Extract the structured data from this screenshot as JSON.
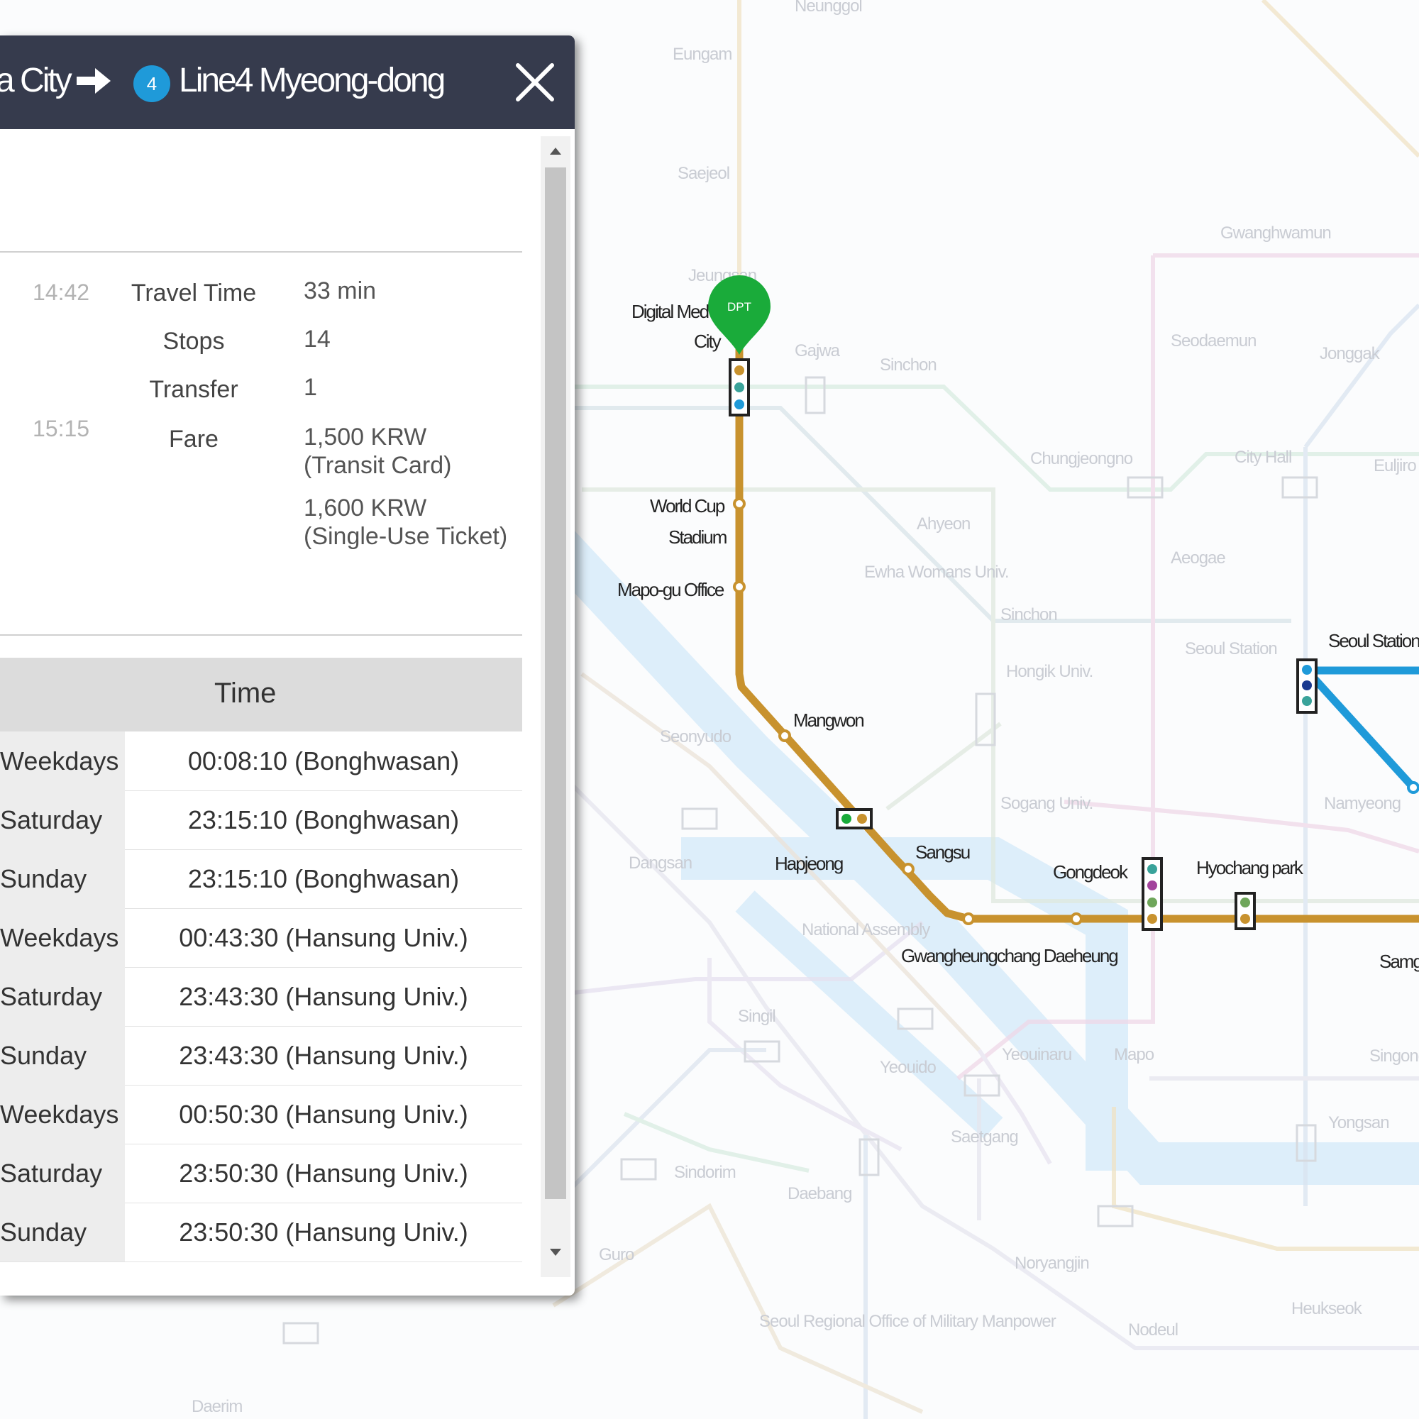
{
  "route": {
    "origin_fragment": "a City",
    "line_number": "4",
    "destination": "Line4 Myeong-dong"
  },
  "summary": {
    "depart_time": "14:42",
    "arrive_time": "15:15",
    "rows": [
      {
        "label": "Travel Time",
        "value": "33 min"
      },
      {
        "label": "Stops",
        "value": "14"
      },
      {
        "label": "Transfer",
        "value": "1"
      },
      {
        "label": "Fare",
        "value": "1,500 KRW"
      }
    ],
    "fare_card_note": "(Transit Card)",
    "fare_single": "1,600 KRW",
    "fare_single_note": "(Single-Use Ticket)"
  },
  "schedule": {
    "header": "Time",
    "rows": [
      {
        "day": "Weekdays",
        "time": "00:08:10 (Bonghwasan)"
      },
      {
        "day": "Saturday",
        "time": "23:15:10 (Bonghwasan)"
      },
      {
        "day": "Sunday",
        "time": "23:15:10 (Bonghwasan)"
      },
      {
        "day": "Weekdays",
        "time": "00:43:30 (Hansung Univ.)"
      },
      {
        "day": "Saturday",
        "time": "23:43:30 (Hansung Univ.)"
      },
      {
        "day": "Sunday",
        "time": "23:43:30 (Hansung Univ.)"
      },
      {
        "day": "Weekdays",
        "time": "00:50:30 (Hansung Univ.)"
      },
      {
        "day": "Saturday",
        "time": "23:50:30 (Hansung Univ.)"
      },
      {
        "day": "Sunday",
        "time": "23:50:30 (Hansung Univ.)"
      }
    ]
  },
  "map": {
    "dpt_marker": "DPT",
    "stations": {
      "digital_media_city_1": "Digital Med",
      "digital_media_city_2": "City",
      "world_cup_stadium_1": "World Cup",
      "world_cup_stadium_2": "Stadium",
      "mapo_gu_office": "Mapo-gu Office",
      "mangwon": "Mangwon",
      "hapjeong": "Hapjeong",
      "sangsu": "Sangsu",
      "gwangheungchang": "Gwangheungchang Daeheung",
      "gongdeok": "Gongdeok",
      "hyochang_park": "Hyochang park",
      "seoul_station": "Seoul Station",
      "samg": "Samg"
    },
    "faint_labels": [
      "Neunggol",
      "Eungam",
      "Saejeol",
      "Jeungsan",
      "Gajwa",
      "Sinchon",
      "Chungjeongno",
      "City Hall",
      "Gwanghwamun",
      "Seodaemun",
      "Jonggak",
      "Euljiro",
      "Ahyeon",
      "Ewha Womans Univ.",
      "Sinchon",
      "Aeogae",
      "Seoul Station",
      "Hongik Univ.",
      "Sogang Univ.",
      "Namyeong",
      "Dangsan",
      "Seonyudo",
      "National Assembly",
      "Yeouido",
      "Yeouinaru",
      "Mapo",
      "Saetgang",
      "Yongsan",
      "Singil",
      "Daebang",
      "Sindorim",
      "Guro",
      "Noryangjin",
      "Nodeul",
      "Heukseok",
      "Seoul Regional Office of Military Manpower",
      "Singong",
      "Daerim"
    ]
  },
  "colors": {
    "header_bg": "#363b4d",
    "line6": "#c8922e",
    "line4": "#1f9ad9",
    "dpt_green": "#1aab3a"
  }
}
